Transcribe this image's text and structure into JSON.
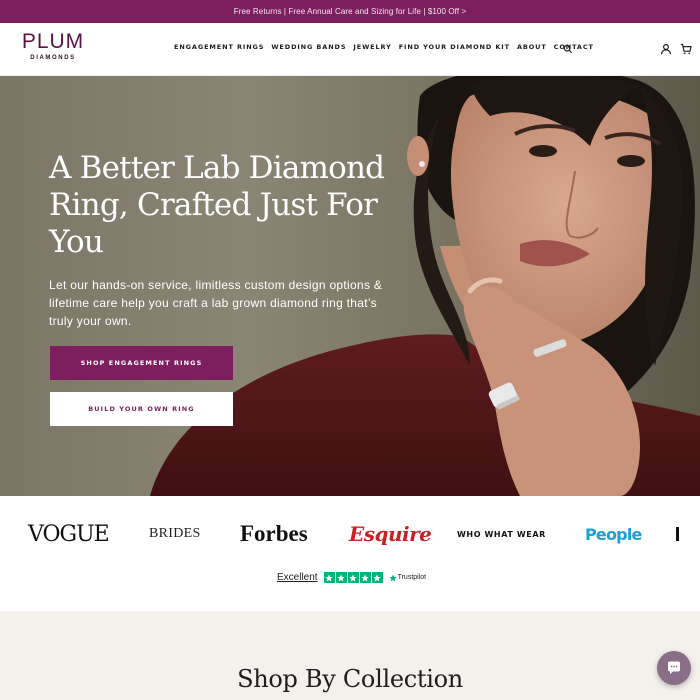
{
  "promo": {
    "text": "Free Returns | Free Annual Care and Sizing for Life | $100 Off >"
  },
  "brand": {
    "name": "PLUM",
    "sub": "DIAMONDS"
  },
  "nav": {
    "items": [
      "ENGAGEMENT RINGS",
      "WEDDING BANDS",
      "JEWELRY",
      "FIND YOUR DIAMOND KIT",
      "ABOUT",
      "CONTACT"
    ]
  },
  "icons": {
    "search": "search-icon",
    "account": "account-icon",
    "cart": "cart-icon",
    "chat": "chat-icon"
  },
  "hero": {
    "title": "A Better Lab Diamond Ring, Crafted Just For You",
    "description": "Let our hands-on service, limitless custom design options & lifetime care help you craft a lab grown diamond ring that’s truly your own.",
    "primary_cta": "SHOP ENGAGEMENT RINGS",
    "secondary_cta": "BUILD YOUR OWN RING"
  },
  "press": {
    "logos": [
      "VOGUE",
      "BRIDES",
      "Forbes",
      "Esquire",
      "WHO WHAT WEAR",
      "People"
    ]
  },
  "trustpilot": {
    "rating_label": "Excellent",
    "stars": 5,
    "brand": "Trustpilot"
  },
  "collection": {
    "title": "Shop By Collection"
  },
  "colors": {
    "brand_plum": "#7d1f5e",
    "trustpilot_green": "#00b67a",
    "esquire_red": "#c92026",
    "people_blue": "#1ba1d8"
  }
}
